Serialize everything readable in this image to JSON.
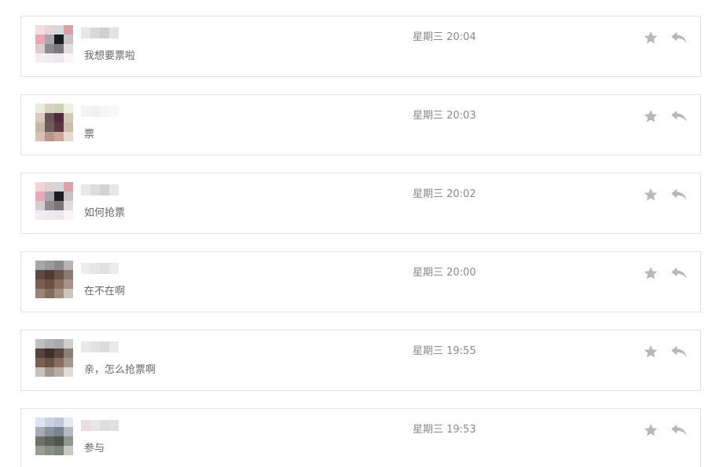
{
  "icons": {
    "star": "star-icon",
    "reply": "reply-icon"
  },
  "colors": {
    "icon": "#b8b8b8",
    "border": "#e4e4e4",
    "time_text": "#8a8a8a",
    "message_text": "#666666"
  },
  "messages": [
    {
      "text": "我想要票啦",
      "time": "星期三 20:04",
      "avatar": [
        "#f2dde0",
        "#e7d2d5",
        "#d4dadb",
        "#d9a0a8",
        "#e9a7b2",
        "#a9a9ad",
        "#1b1b1d",
        "#c9c4c8",
        "#d8cdd2",
        "#8e8a8d",
        "#7b7678",
        "#e6dde1",
        "#f3eef0",
        "#f1eaee",
        "#ece7ea",
        "#faf6f8"
      ],
      "name_blur": [
        "#e7e7e7",
        "#d9d9d9",
        "#d0d0d0",
        "#e3e3e3"
      ]
    },
    {
      "text": "票",
      "time": "星期三 20:03",
      "avatar": [
        "#e9ecd8",
        "#d8d3c1",
        "#cfd0b8",
        "#ecf0de",
        "#d6ccbd",
        "#6a5558",
        "#4e2b38",
        "#d2c7bb",
        "#c8b7a8",
        "#6f5b5b",
        "#5b3743",
        "#cbbdb0",
        "#d8c2b6",
        "#b89589",
        "#c7a89a",
        "#eadad2"
      ],
      "name_blur": [
        "#f3f3f3",
        "#f0f0f0",
        "#f5f5f5",
        "#f8f8f8"
      ]
    },
    {
      "text": "如何抢票",
      "time": "星期三 20:02",
      "avatar": [
        "#f0d5da",
        "#e3d0d3",
        "#d2d6d8",
        "#dba2aa",
        "#e7a9b3",
        "#a8a7ab",
        "#1d1d1f",
        "#c8c3c7",
        "#d7ccd1",
        "#908b8e",
        "#7b7678",
        "#e4dbe0",
        "#f1ecef",
        "#efe8ec",
        "#ebe6e9",
        "#f8f4f6"
      ],
      "name_blur": [
        "#e9e9e9",
        "#dcdcdc",
        "#d2d2d2",
        "#e6e6e6"
      ]
    },
    {
      "text": "在不在啊",
      "time": "星期三 20:00",
      "avatar": [
        "#a6a6a6",
        "#9a9a9a",
        "#8c8c8c",
        "#b5b5b5",
        "#5e4a40",
        "#4e3c34",
        "#6a5449",
        "#8a7a72",
        "#7b5e50",
        "#6d5244",
        "#8c6e5f",
        "#a99286",
        "#9a8378",
        "#856b5f",
        "#a48e82",
        "#cfc6c1"
      ],
      "name_blur": [
        "#ececec",
        "#e6e6e6",
        "#e1e1e1",
        "#ebebeb"
      ]
    },
    {
      "text": "亲，怎么抢票啊",
      "time": "星期三 19:55",
      "avatar": [
        "#bfbfbf",
        "#b0b0b0",
        "#a9a9a9",
        "#cfcfcf",
        "#56433a",
        "#3f302a",
        "#5a4840",
        "#888079",
        "#7a5f52",
        "#6b5044",
        "#8a6c5e",
        "#a89589",
        "#c9c1bb",
        "#a4968c",
        "#b8aca4",
        "#e0dbd7"
      ],
      "name_blur": [
        "#e8e8e8",
        "#e2e2e2",
        "#dcdcdc",
        "#e9e9e9"
      ]
    },
    {
      "text": "参与",
      "time": "星期三 19:53",
      "avatar": [
        "#dfe3f1",
        "#cdd1e6",
        "#c1c5de",
        "#e6e9f4",
        "#a7adb8",
        "#8a919b",
        "#7a828d",
        "#b3b9c2",
        "#6c7266",
        "#5c6259",
        "#4f564b",
        "#8f958b",
        "#999f95",
        "#889084",
        "#7d8579",
        "#c5c9c1"
      ],
      "name_blur": [
        "#eadde2",
        "#e7e7e7",
        "#dedede",
        "#e1e1e1"
      ]
    }
  ]
}
